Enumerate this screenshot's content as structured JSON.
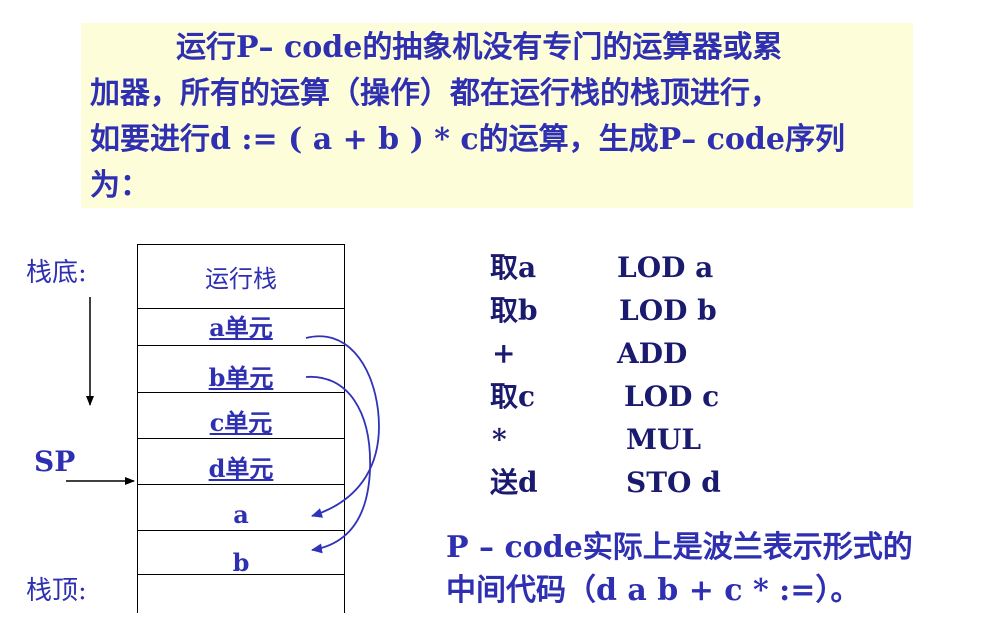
{
  "intro": {
    "lines": [
      "运行P– code的抽象机没有专门的运算器或累",
      "加器，所有的运算（操作）都在运行栈的栈顶进行，",
      "如要进行d := ( a + b ) * c的运算，生成P– code序列",
      "为："
    ]
  },
  "labels": {
    "stack_bottom": "栈底:",
    "stack_top": "栈顶:",
    "sp": "SP"
  },
  "stack": {
    "title": "运行栈",
    "cells": [
      "a单元",
      "b单元",
      "c单元",
      "d单元",
      "a",
      "b",
      ""
    ]
  },
  "instructions": [
    {
      "action": "取a",
      "code": "LOD a"
    },
    {
      "action": "取b",
      "code": "LOD b"
    },
    {
      "action": "+",
      "code": "ADD"
    },
    {
      "action": "取c",
      "code": "LOD c"
    },
    {
      "action": "*",
      "code": "MUL"
    },
    {
      "action": "送d",
      "code": "STO d"
    }
  ],
  "note": {
    "lines": [
      "P – code实际上是波兰表示形式的",
      "中间代码（d a b + c * :=）。"
    ]
  },
  "colors": {
    "text": "#2e2fb1",
    "code": "#1a1a6e",
    "intro_bg": "#fdfdd9",
    "arrow": "#3033b8"
  }
}
